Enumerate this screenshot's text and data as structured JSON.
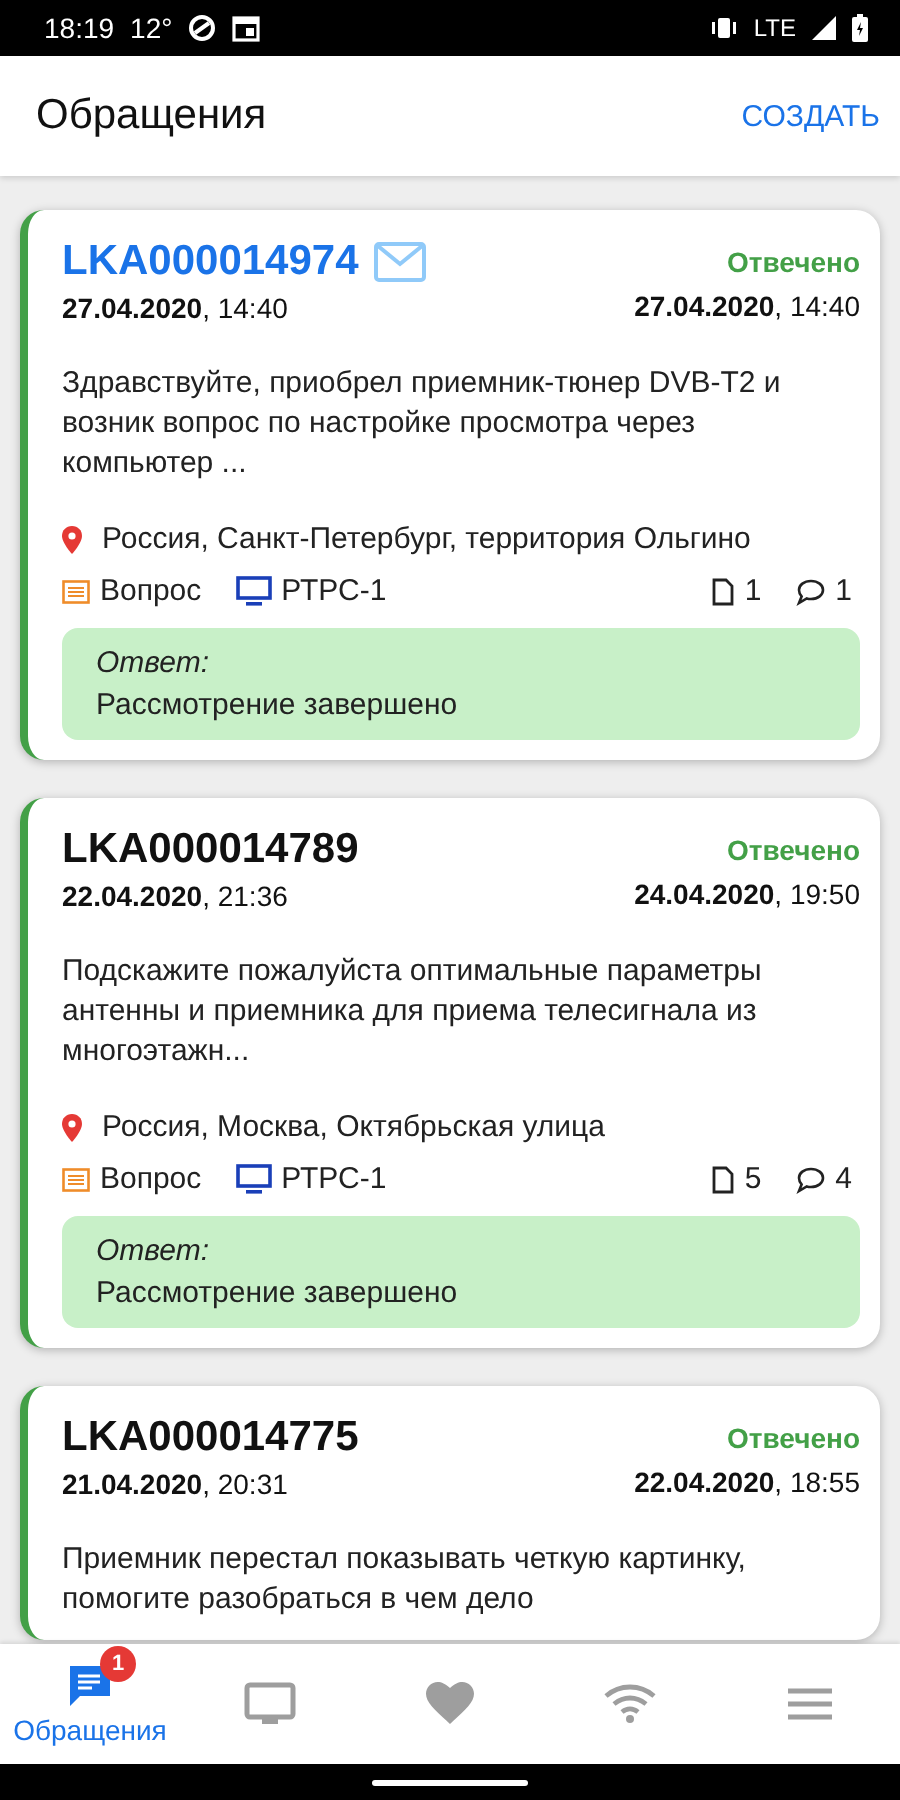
{
  "status_bar": {
    "time": "18:19",
    "temperature": "12°",
    "network": "LTE"
  },
  "app_bar": {
    "title": "Обращения",
    "action": "СОЗДАТЬ"
  },
  "tickets": [
    {
      "id": "LKA000014974",
      "unread": true,
      "status": "Отвечено",
      "created": "**27.04.2020**, 14:40",
      "answered": "**27.04.2020**, 14:40",
      "text": "Здравствуйте, приобрел приемник-тюнер DVB-T2 и возник вопрос по настройке просмотра через компьютер ...",
      "location": "Россия, Санкт-Петербург, территория Ольгино",
      "type": "Вопрос",
      "channel": "РТРС-1",
      "files": "1",
      "comments": "1",
      "answer_label": "Ответ:",
      "answer": "Рассмотрение завершено"
    },
    {
      "id": "LKA000014789",
      "unread": false,
      "status": "Отвечено",
      "created": "**22.04.2020**, 21:36",
      "answered": "**24.04.2020**, 19:50",
      "text": "Подскажите пожалуйста оптимальные параметры антенны и приемника для приема телесигнала из многоэтажн...",
      "location": "Россия, Москва, Октябрьская улица",
      "type": "Вопрос",
      "channel": "РТРС-1",
      "files": "5",
      "comments": "4",
      "answer_label": "Ответ:",
      "answer": "Рассмотрение завершено"
    },
    {
      "id": "LKA000014775",
      "unread": false,
      "status": "Отвечено",
      "created": "**21.04.2020**, 20:31",
      "answered": "**22.04.2020**, 18:55",
      "text": "Приемник перестал показывать четкую картинку, помогите разобраться в чем дело"
    }
  ],
  "nav": [
    {
      "kind": "chat",
      "label": "Обращения",
      "badge": "1",
      "selected": true
    },
    {
      "kind": "tv",
      "selected": false
    },
    {
      "kind": "heart",
      "selected": false
    },
    {
      "kind": "wifi",
      "selected": false
    },
    {
      "kind": "menu",
      "selected": false
    }
  ]
}
